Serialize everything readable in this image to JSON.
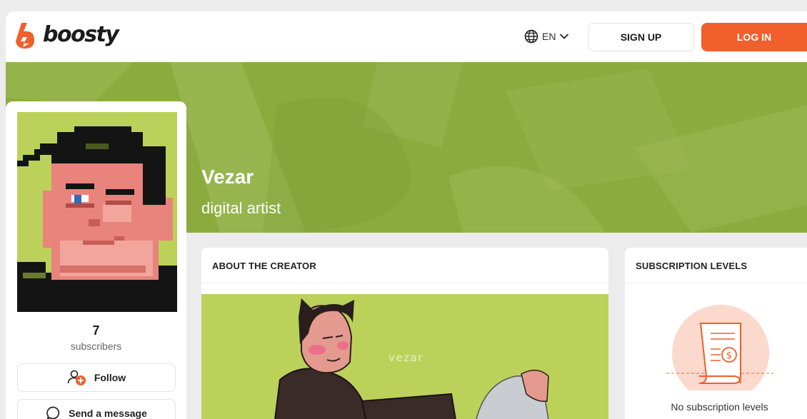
{
  "header": {
    "logo_text": "boosty",
    "language": "EN",
    "signup_label": "SIGN UP",
    "login_label": "LOG IN"
  },
  "creator": {
    "name": "Vezar",
    "tagline": "digital artist",
    "subscribers_count": "7",
    "subscribers_label": "subscribers",
    "follow_label": "Follow",
    "message_label": "Send a message"
  },
  "about": {
    "title": "ABOUT THE CREATOR",
    "art_signature": "vezar"
  },
  "levels": {
    "title": "SUBSCRIPTION LEVELS",
    "empty_text": "No subscription levels"
  },
  "colors": {
    "accent": "#f15f2c",
    "cover_green": "#8bab3f",
    "avatar_bg": "#bcd15a",
    "skin": "#e8847b"
  },
  "icons": {
    "logo": "boosty-flame-icon",
    "language": "globe-icon",
    "dropdown": "chevron-down-icon",
    "follow": "user-plus-icon",
    "message": "chat-bubble-icon",
    "empty_levels": "receipt-dollar-icon"
  }
}
